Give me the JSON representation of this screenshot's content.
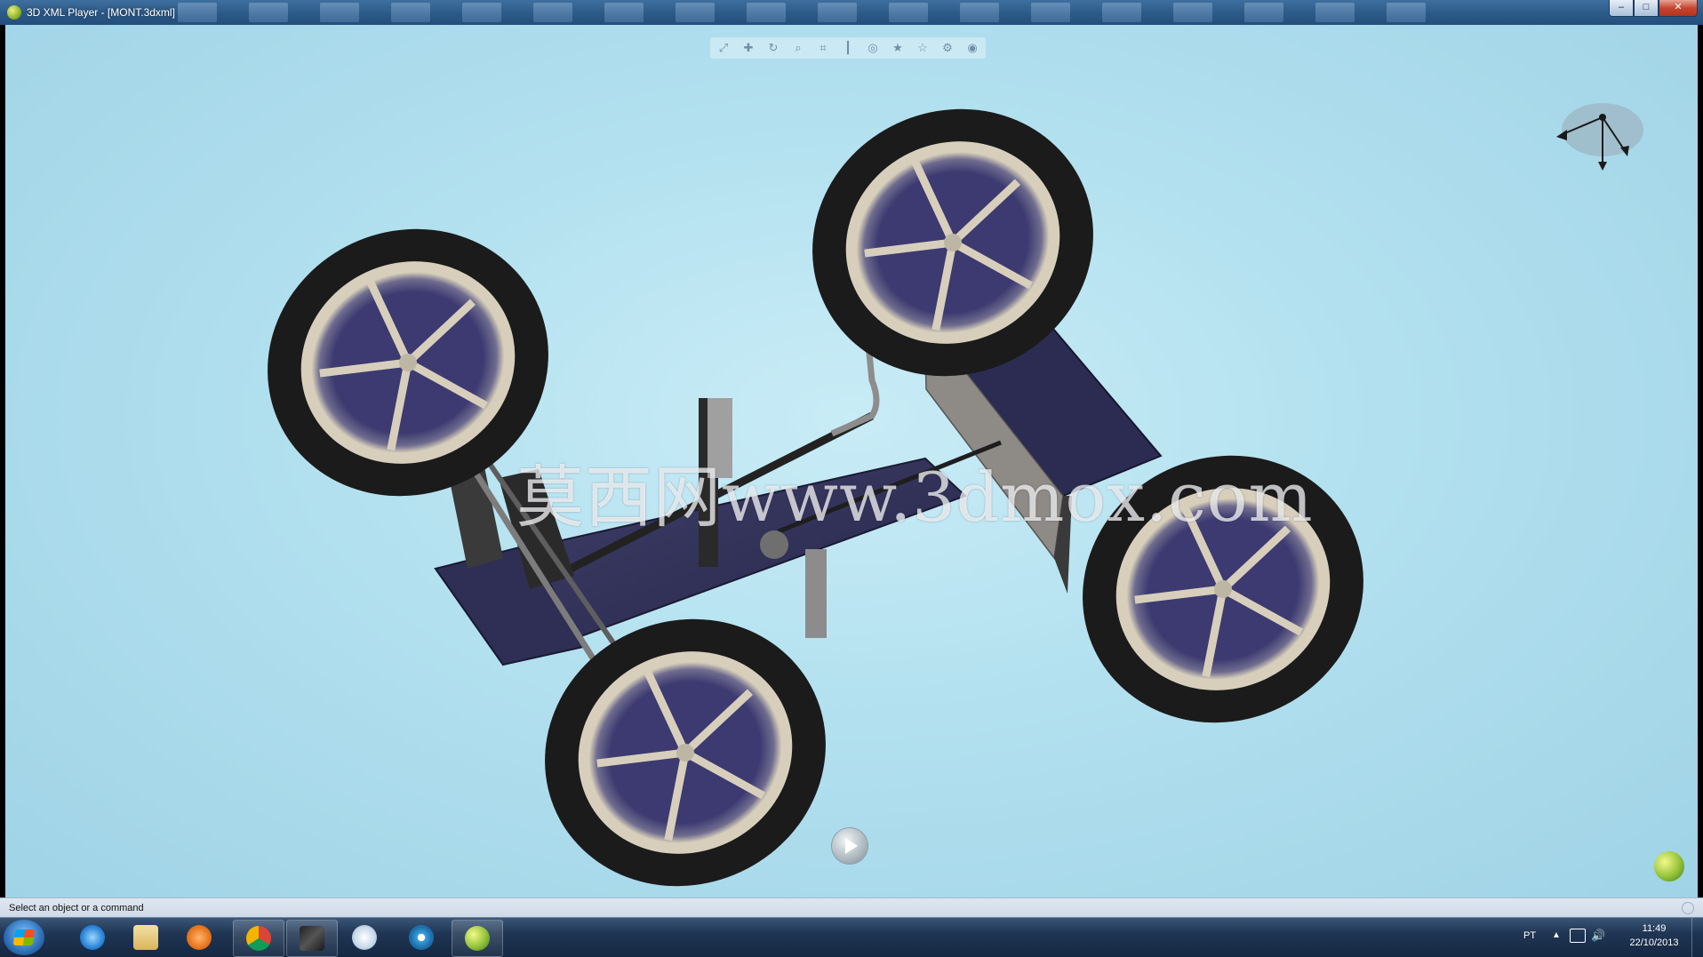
{
  "window": {
    "title": "3D XML Player - [MONT.3dxml]",
    "buttons": {
      "minimize": "–",
      "maximize": "□",
      "close": "✕"
    }
  },
  "toolbar": {
    "tools": [
      "fit-all-icon",
      "pan-icon",
      "rotate-icon",
      "zoom-icon",
      "zoom-area-icon",
      "section-icon",
      "view-icon",
      "star-icon",
      "favorite-icon",
      "settings-icon",
      "more-icon"
    ],
    "glyphs": [
      "⤢",
      "✚",
      "↻",
      "⌕",
      "⌗",
      "┃",
      "◎",
      "★",
      "☆",
      "⚙",
      "◉"
    ]
  },
  "watermark": "莫西网www.3dmox.com",
  "statusbar": {
    "message": "Select an object or a command"
  },
  "taskbar": {
    "apps": [
      "internet-explorer",
      "file-explorer",
      "media-player",
      "chrome",
      "3d-modeler",
      "paint",
      "network-app",
      "3dxml-player"
    ],
    "tray": {
      "language": "PT",
      "time": "11:49",
      "date": "22/10/2013"
    }
  },
  "colors": {
    "viewport_bg": "#b2e0ef",
    "chassis": "#33335a",
    "tire": "#1b1b1b",
    "rim": "#cfc7b6",
    "metal": "#9ea3a8"
  }
}
